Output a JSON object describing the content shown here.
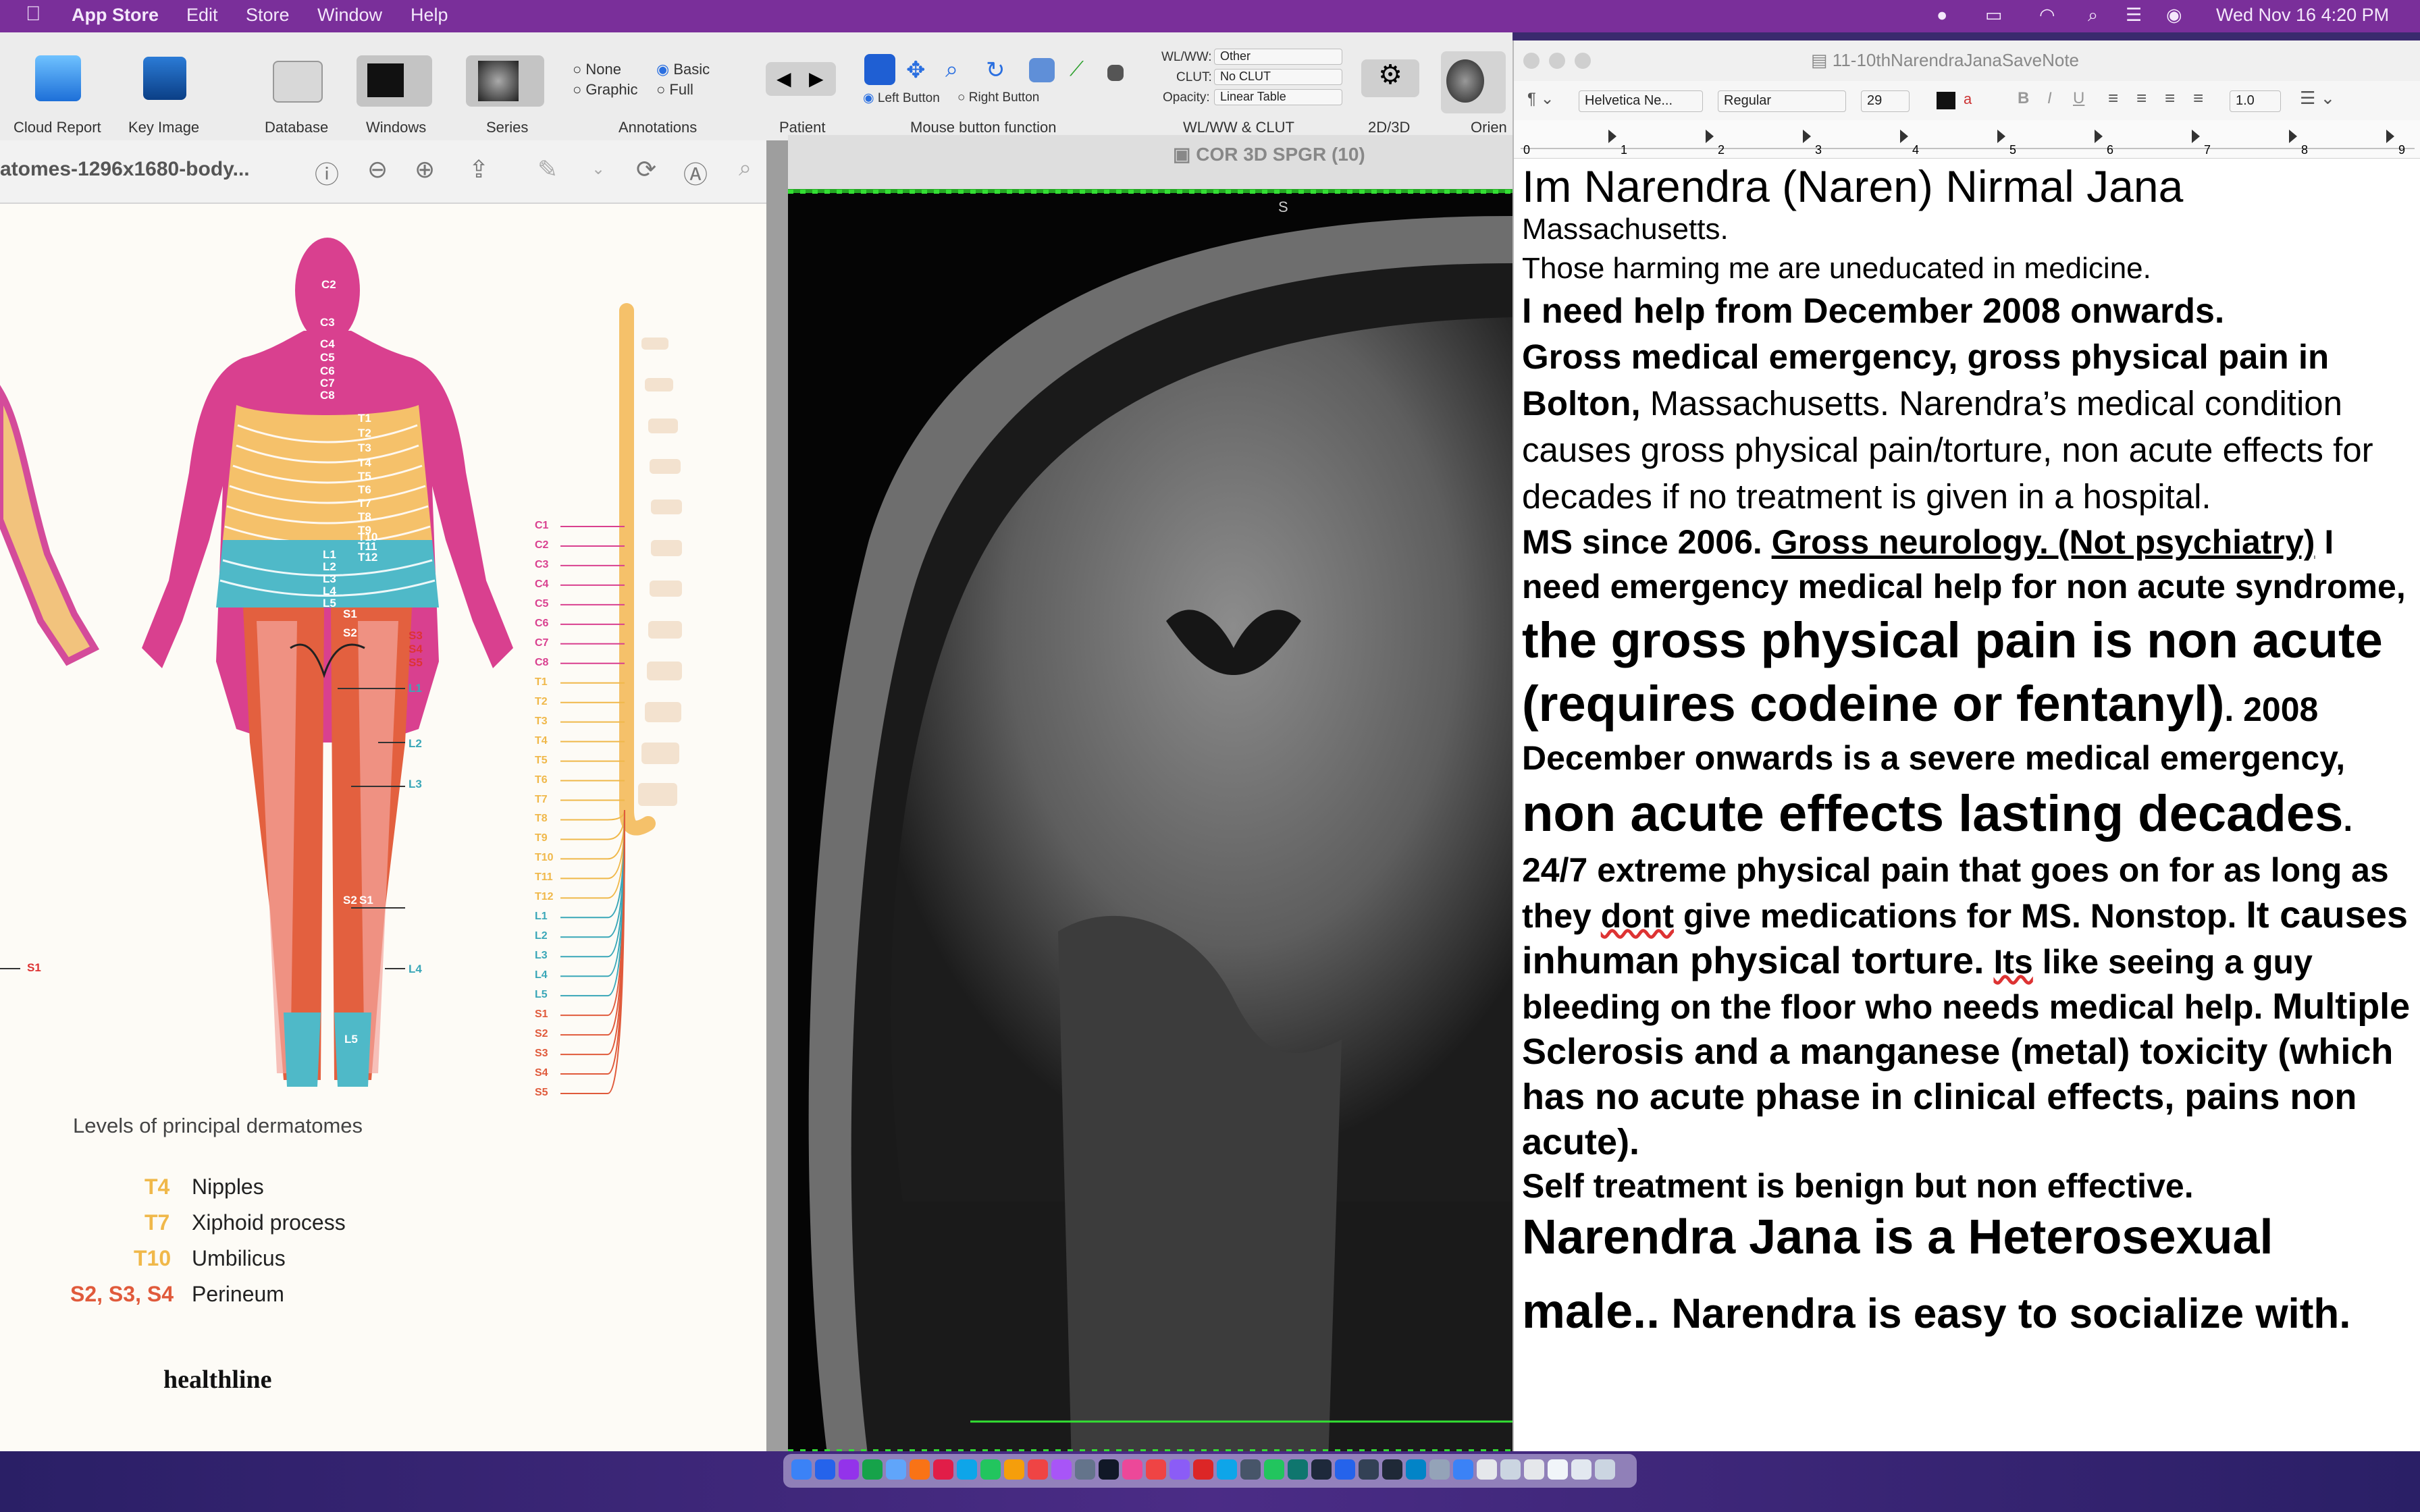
{
  "menubar": {
    "app": "App Store",
    "items": [
      "Edit",
      "Store",
      "Window",
      "Help"
    ],
    "datetime": "Wed Nov 16  4:20 PM"
  },
  "toolbar": {
    "cloud_report": "Cloud Report",
    "key_image": "Key Image",
    "database": "Database",
    "windows": "Windows",
    "series": "Series",
    "annotations": {
      "label": "Annotations",
      "none": "None",
      "graphic": "Graphic",
      "basic": "Basic",
      "full": "Full"
    },
    "patient": "Patient",
    "mouse_function": "Mouse button function",
    "left_button": "Left Button",
    "right_button": "Right Button",
    "wlww_label": "WL/WW:",
    "wlww_value": "Other",
    "clut_label": "CLUT:",
    "clut_value": "No CLUT",
    "opacity_label": "Opacity:",
    "opacity_value": "Linear Table",
    "wlww_clut": "WL/WW & CLUT",
    "mode_2d3d": "2D/3D",
    "orientation": "Orien"
  },
  "preview": {
    "title": "atomes-1296x1680-body...",
    "chart_title": "Levels of principal dermatomes",
    "legend": [
      {
        "level": "T4",
        "label": "Nipples"
      },
      {
        "level": "T7",
        "label": "Xiphoid process"
      },
      {
        "level": "T10",
        "label": "Umbilicus"
      },
      {
        "level": "S2, S3, S4",
        "label": "Perineum"
      }
    ],
    "logo": "healthline",
    "body_labels": {
      "c2": "C2",
      "c3": "C3",
      "c4": "C4",
      "c5": "C5",
      "c6": "C6",
      "c7": "C7",
      "c8": "C8",
      "t1": "T1",
      "t2": "T2",
      "t3": "T3",
      "t4": "T4",
      "t5": "T5",
      "t6": "T6",
      "t7": "T7",
      "t8": "T8",
      "t9": "T9",
      "t10": "T10",
      "t11": "T11",
      "t12": "T12",
      "l1": "L1",
      "l2": "L2",
      "l3": "L3",
      "l4": "L4",
      "l5": "L5",
      "s1": "S1",
      "s2": "S2",
      "s3": "S3",
      "s4": "S4",
      "s5": "S5"
    },
    "spine_labels": [
      "C1",
      "C2",
      "C3",
      "C4",
      "C5",
      "C6",
      "C7",
      "C8",
      "T1",
      "T2",
      "T3",
      "T4",
      "T5",
      "T6",
      "T7",
      "T8",
      "T9",
      "T10",
      "T11",
      "T12",
      "L1",
      "L2",
      "L3",
      "L4",
      "L5",
      "S1",
      "S2",
      "S3",
      "S4",
      "S5"
    ],
    "left_edge_label": "S1"
  },
  "viewer": {
    "title": "COR 3D SPGR (10)",
    "orientation_top": "S"
  },
  "textedit": {
    "title": "11-10thNarendraJanaSaveNote",
    "font": "Helvetica Ne...",
    "style": "Regular",
    "size": "29",
    "spacing": "1.0",
    "ruler": [
      "0",
      "1",
      "2",
      "3",
      "4",
      "5",
      "6",
      "7",
      "8",
      "9"
    ],
    "lines": {
      "l1": "Im Narendra (Naren) Nirmal Jana",
      "l2": "Massachusetts.",
      "l3": "Those harming me are uneducated in medicine.",
      "l4": "I need help from December 2008 onwards.",
      "l5a": "Gross medical emergency, gross physical pain in Bolton,",
      "l5b": " Massachusetts. Narendra’s medical condition causes gross physical pain/torture, non acute effects for decades if no treatment is given in a hospital.",
      "l6a": "MS since 2006. ",
      "l6b": "Gross neurology. (Not psychiatry)",
      "l6c": " I need emergency medical help for non acute syndrome, ",
      "l6d": "the gross physical pain is non acute (requires codeine or fentanyl)",
      "l6e": ". 2008 December onwards is a severe medical emergency, ",
      "l6f": "non acute effects lasting decades",
      "l6g": ".  24/7 extreme physical pain that goes on for as long as they ",
      "l6h": "dont",
      "l6i": " give medications for MS. Nonstop. ",
      "l6j": "It causes inhuman physical torture.",
      "l6k": " ",
      "l6l": "Its",
      "l6m": " like seeing a guy bleeding on the floor who needs medical help.  ",
      "l6n": "Multiple Sclerosis and a manganese (metal) toxicity (which has no acute phase in clinical effects, pains non acute).",
      "l7": "Self treatment is benign but non effective.",
      "l8a": "Narendra Jana is a Heterosexual male..",
      "l8b": " Narendra is easy to socialize with."
    }
  }
}
